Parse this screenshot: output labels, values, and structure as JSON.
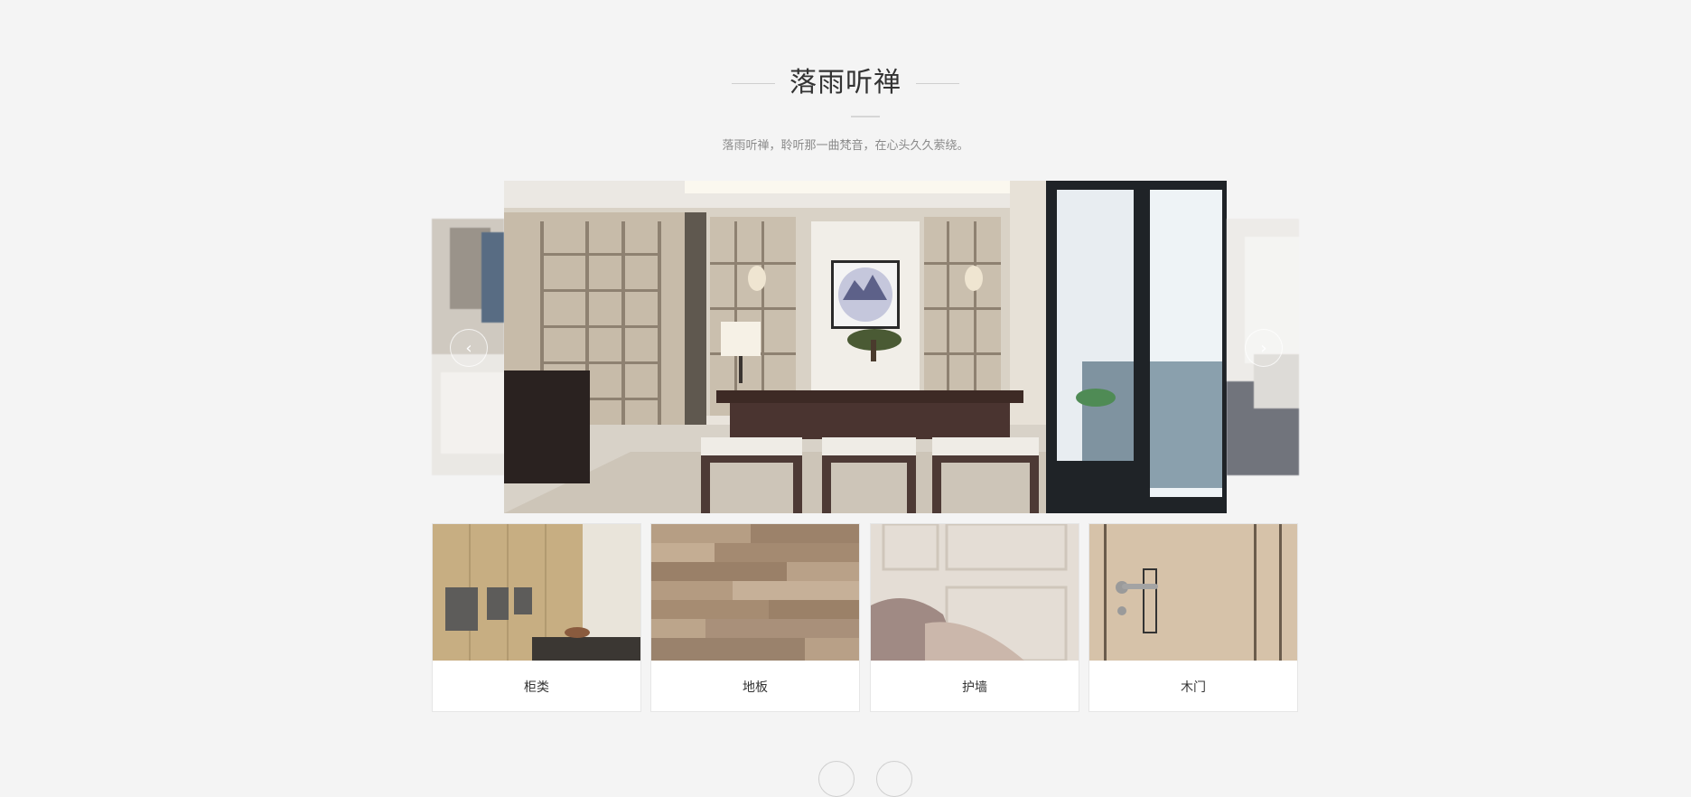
{
  "section": {
    "title": "落雨听禅",
    "subtitle": "落雨听禅，聆听那一曲梵音，在心头久久萦绕。"
  },
  "carousel": {
    "prev_icon": "chevron-left-icon",
    "next_icon": "chevron-right-icon",
    "prev_symbol": "‹",
    "next_symbol": "›"
  },
  "categories": [
    {
      "label": "柜类"
    },
    {
      "label": "地板"
    },
    {
      "label": "护墙"
    },
    {
      "label": "木门"
    }
  ],
  "colors": {
    "background": "#f4f4f4",
    "title": "#333333",
    "subtitle": "#8a8a8a"
  }
}
